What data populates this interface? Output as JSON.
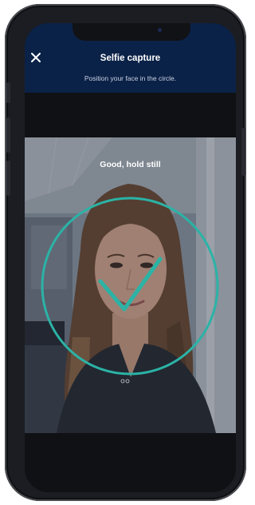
{
  "header": {
    "title": "Selfie capture",
    "instruction": "Position your face in the circle.",
    "close_icon": "close-icon",
    "background_color": "#0b2248"
  },
  "camera": {
    "feedback_text": "Good, hold still",
    "status_icon": "checkmark-icon",
    "accent_color": "#2bb3a6"
  }
}
